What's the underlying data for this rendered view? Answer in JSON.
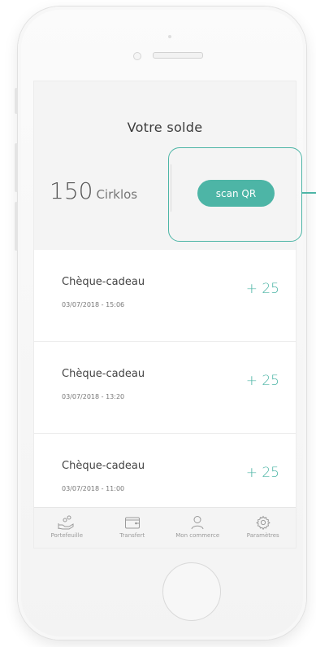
{
  "header": {
    "title": "Votre solde",
    "balance_value": "150",
    "balance_unit": "Cirklos",
    "scan_label": "scan QR"
  },
  "transactions": [
    {
      "label": "Chèque-cadeau",
      "date": "03/07/2018 - 15:06",
      "amount": "+ 25"
    },
    {
      "label": "Chèque-cadeau",
      "date": "03/07/2018 - 13:20",
      "amount": "+ 25"
    },
    {
      "label": "Chèque-cadeau",
      "date": "03/07/2018 - 11:00",
      "amount": "+ 25"
    }
  ],
  "nav": [
    {
      "label": "Portefeuille",
      "icon": "wallet-hand-icon"
    },
    {
      "label": "Transfert",
      "icon": "card-wallet-icon"
    },
    {
      "label": "Mon commerce",
      "icon": "user-icon"
    },
    {
      "label": "Paramètres",
      "icon": "gear-icon"
    }
  ],
  "colors": {
    "accent": "#4db5a6",
    "header_bg": "#f4f4f4",
    "text": "#444444"
  }
}
